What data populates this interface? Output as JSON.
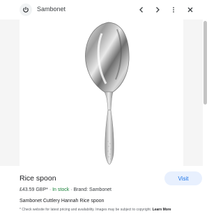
{
  "header": {
    "source_name": "Sambonet",
    "icons": [
      "power-icon",
      "chevron-left-icon",
      "chevron-right-icon",
      "more-vert-icon",
      "close-icon"
    ]
  },
  "image": {
    "subject": "spoon-image"
  },
  "product": {
    "title": "Rice spoon",
    "visit_label": "Visit",
    "price": "£43.59 GBP*",
    "stock": "In stock",
    "brand": "Brand: Sambonet",
    "description": "Sambonet Cuttlery Hannah Rice spoon",
    "disclaimer": "* Check website for latest pricing and availability. Images may be subject to copyright.",
    "learn_more": "Learn More"
  },
  "colors": {
    "accent": "#1a73e8",
    "visit_bg": "#e8f0fe",
    "stock": "#188038",
    "side_panel": "#f5f5f5"
  }
}
